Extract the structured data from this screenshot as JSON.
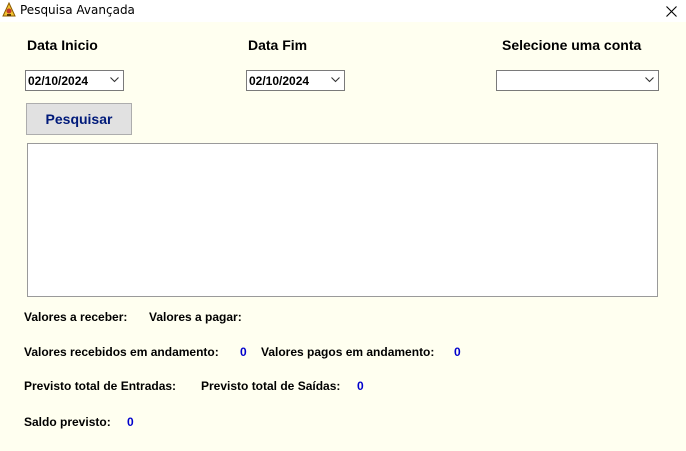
{
  "window": {
    "title": "Pesquisa Avançada"
  },
  "filters": {
    "start_label": "Data Inicio",
    "start_value": "02/10/2024",
    "end_label": "Data Fim",
    "end_value": "02/10/2024",
    "account_label": "Selecione uma conta",
    "account_value": ""
  },
  "search_button": "Pesquisar",
  "results": [],
  "summary": {
    "receivable_label": "Valores a receber:",
    "payable_label": "Valores a pagar:",
    "received_in_progress_label": "Valores recebidos em andamento:",
    "received_in_progress_value": "0",
    "paid_in_progress_label": "Valores pagos em andamento:",
    "paid_in_progress_value": "0",
    "expected_inflows_label": "Previsto total de Entradas:",
    "expected_outflows_label": "Previsto total de Saídas:",
    "expected_outflows_value": "0",
    "expected_balance_label": "Saldo previsto:",
    "expected_balance_value": "0"
  },
  "colors": {
    "background": "#fffff0",
    "value_text": "#0000cc",
    "button_text": "#001a7a"
  },
  "icons": [
    "app-icon",
    "close-icon",
    "chevron-down-icon"
  ]
}
